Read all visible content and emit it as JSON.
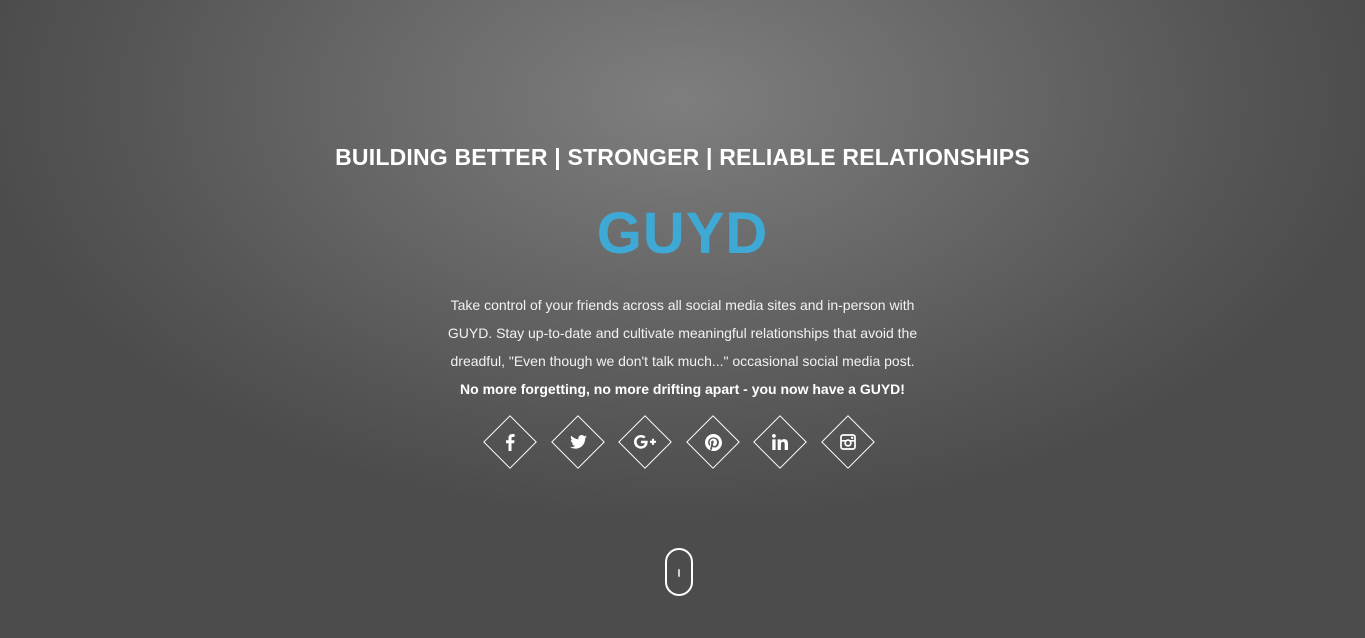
{
  "hero": {
    "tagline": "BUILDING BETTER | STRONGER | RELIABLE RELATIONSHIPS",
    "brand": "GUYD",
    "description": "Take control of your friends across all social media sites and in-person with GUYD. Stay up-to-date and cultivate meaningful relationships that avoid the dreadful, \"Even though we don't talk much...\" occasional social media post.",
    "emphasis": "No more forgetting, no more drifting apart - you now have a GUYD!"
  },
  "social": [
    {
      "name": "facebook-icon"
    },
    {
      "name": "twitter-icon"
    },
    {
      "name": "google-plus-icon"
    },
    {
      "name": "pinterest-icon"
    },
    {
      "name": "linkedin-icon"
    },
    {
      "name": "instagram-icon"
    }
  ],
  "colors": {
    "brand": "#3fa9d6",
    "text": "#ffffff",
    "background": "#5a5a5a"
  }
}
